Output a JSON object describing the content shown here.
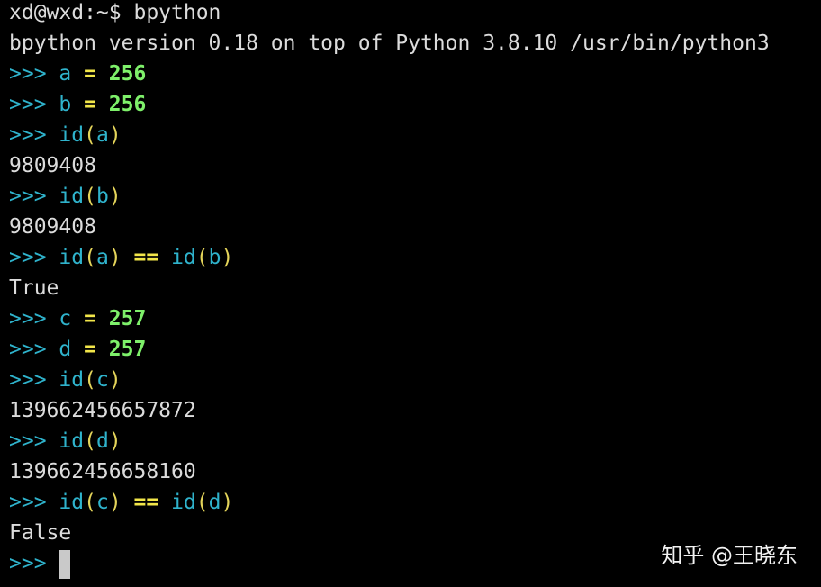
{
  "terminal": {
    "shell_prompt": "xd@wxd:~$",
    "command": " bpython",
    "version_info": "bpython version 0.18 on top of Python 3.8.10 /usr/bin/python3",
    "repl_prompt": ">>> ",
    "lines": {
      "l1": {
        "var": "a",
        "op": " = ",
        "value": "256"
      },
      "l2": {
        "var": "b",
        "op": " = ",
        "value": "256"
      },
      "l3": {
        "func": "id",
        "open": "(",
        "arg": "a",
        "close": ")"
      },
      "l4": {
        "output": "9809408"
      },
      "l5": {
        "func": "id",
        "open": "(",
        "arg": "b",
        "close": ")"
      },
      "l6": {
        "output": "9809408"
      },
      "l7": {
        "func1": "id",
        "arg1": "a",
        "eq": " == ",
        "func2": "id",
        "arg2": "b"
      },
      "l8": {
        "output": "True"
      },
      "l9": {
        "var": "c",
        "op": " = ",
        "value": "257"
      },
      "l10": {
        "var": "d",
        "op": " = ",
        "value": "257"
      },
      "l11": {
        "func": "id",
        "open": "(",
        "arg": "c",
        "close": ")"
      },
      "l12": {
        "output": "139662456657872"
      },
      "l13": {
        "func": "id",
        "open": "(",
        "arg": "d",
        "close": ")"
      },
      "l14": {
        "output": "139662456658160"
      },
      "l15": {
        "func1": "id",
        "arg1": "c",
        "eq": " == ",
        "func2": "id",
        "arg2": "d"
      },
      "l16": {
        "output": "False"
      }
    }
  },
  "watermark": {
    "text": "知乎 @王晓东"
  },
  "colors": {
    "background": "#000000",
    "prompt": "#2fb3cc",
    "number": "#7ef06a",
    "operator": "#f2e64a",
    "paren": "#e4d45a",
    "output": "#dcdcdc",
    "cursor": "#c9c9c9"
  }
}
